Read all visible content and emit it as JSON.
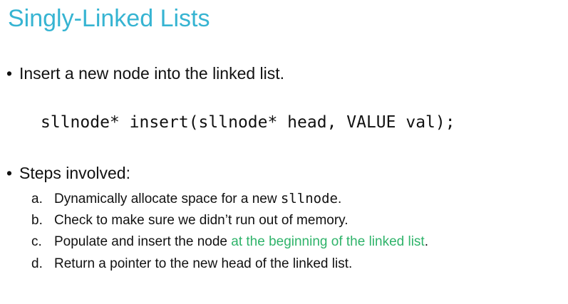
{
  "slide": {
    "title": "Singly-Linked Lists",
    "bullet1": "Insert a new node into the linked list.",
    "bullet_glyph": "•",
    "code_line": "sllnode* insert(sllnode* head, VALUE val);",
    "bullet2": "Steps involved:",
    "steps": [
      {
        "letter": "a.",
        "before": "Dynamically allocate space for a new ",
        "code": "sllnode",
        "after": "."
      },
      {
        "letter": "b.",
        "text": "Check to make sure we didn’t run out of memory."
      },
      {
        "letter": "c.",
        "before": "Populate and insert the node ",
        "highlight": "at the beginning of the linked list",
        "after": "."
      },
      {
        "letter": "d.",
        "text": "Return a pointer to the new head of the linked list."
      }
    ]
  },
  "colors": {
    "title": "#36b4d2",
    "highlight": "#2fb36a",
    "text": "#111111"
  }
}
